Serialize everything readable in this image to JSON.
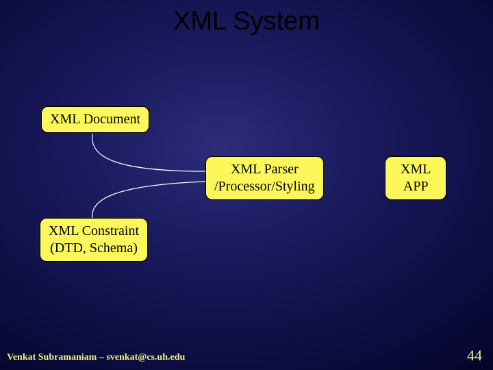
{
  "title": "XML System",
  "nodes": {
    "document": "XML Document",
    "parser": "XML Parser\n/Processor/Styling",
    "app": "XML\nAPP",
    "constraint": "XML Constraint\n(DTD, Schema)"
  },
  "footer": "Venkat Subramaniam – svenkat@cs.uh.edu",
  "page": "44"
}
